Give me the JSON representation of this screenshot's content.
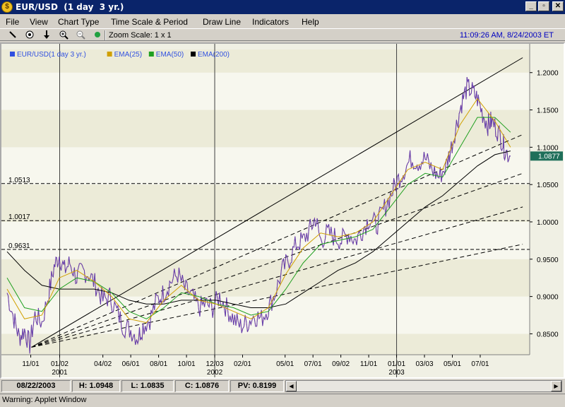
{
  "window": {
    "title": "EUR/USD  (1 day  3 yr.)",
    "icon_letter": "$",
    "controls": {
      "minimize": "_",
      "restore": "▫",
      "close": "✕"
    }
  },
  "menu": {
    "items": [
      "File",
      "View",
      "Chart Type",
      "Time Scale & Period",
      "Draw Line",
      "Indicators",
      "Help"
    ]
  },
  "toolbar": {
    "icons": [
      "draw-line-icon",
      "radio-target-icon",
      "down-arrow-icon",
      "zoom-in-icon",
      "zoom-out-icon",
      "green-dot-icon"
    ],
    "zoom_label": "Zoom Scale: 1 x 1",
    "clock": "11:09:26 AM, 8/24/2003 ET"
  },
  "chart_data": {
    "type": "line",
    "legend": [
      {
        "label": "EUR/USD(1 day  3 yr.)",
        "color": "#3050e0"
      },
      {
        "label": "EMA(25)",
        "color": "#d0a000"
      },
      {
        "label": "EMA(50)",
        "color": "#20a020"
      },
      {
        "label": "EMA(200)",
        "color": "#000000"
      }
    ],
    "y_ticks": [
      "1.2000",
      "1.1500",
      "1.1000",
      "1.0500",
      "1.0000",
      "0.9500",
      "0.9000",
      "0.8500"
    ],
    "ylim": [
      0.822,
      1.231
    ],
    "x_ticks": [
      {
        "label": "11/01",
        "t": 0.068
      },
      {
        "label": "01/02",
        "t": 0.151
      },
      {
        "label": "04/02",
        "t": 0.275
      },
      {
        "label": "06/01",
        "t": 0.355
      },
      {
        "label": "08/01",
        "t": 0.435
      },
      {
        "label": "10/01",
        "t": 0.515
      },
      {
        "label": "12/03",
        "t": 0.596
      },
      {
        "label": "02/01",
        "t": 0.676
      },
      {
        "label": "05/01",
        "t": 0.798
      },
      {
        "label": "07/01",
        "t": 0.878
      },
      {
        "label": "09/02",
        "t": 0.958
      },
      {
        "label": "11/01",
        "t": 1.038
      },
      {
        "label": "01/01",
        "t": 1.118
      },
      {
        "label": "03/03",
        "t": 1.198
      },
      {
        "label": "05/01",
        "t": 1.278
      },
      {
        "label": "07/01",
        "t": 1.358
      }
    ],
    "year_labels": [
      {
        "label": "2001",
        "t": 0.151
      },
      {
        "label": "2002",
        "t": 0.596
      },
      {
        "label": "2003",
        "t": 1.118
      }
    ],
    "year_separators": [
      0.151,
      0.596,
      1.118
    ],
    "last_price_label": "1.0877",
    "last_price": 1.0877,
    "fib_labels": [
      {
        "label": "1.0513",
        "price": 1.0513
      },
      {
        "label": "1.0017",
        "price": 1.0017
      },
      {
        "label": "0.9631",
        "price": 0.9631
      }
    ],
    "price_path": [
      [
        0.0,
        0.905
      ],
      [
        0.02,
        0.87
      ],
      [
        0.035,
        0.845
      ],
      [
        0.05,
        0.855
      ],
      [
        0.065,
        0.835
      ],
      [
        0.08,
        0.875
      ],
      [
        0.1,
        0.865
      ],
      [
        0.12,
        0.905
      ],
      [
        0.135,
        0.94
      ],
      [
        0.15,
        0.955
      ],
      [
        0.165,
        0.935
      ],
      [
        0.18,
        0.945
      ],
      [
        0.2,
        0.925
      ],
      [
        0.215,
        0.935
      ],
      [
        0.235,
        0.93
      ],
      [
        0.255,
        0.915
      ],
      [
        0.275,
        0.895
      ],
      [
        0.295,
        0.9
      ],
      [
        0.315,
        0.88
      ],
      [
        0.335,
        0.86
      ],
      [
        0.355,
        0.855
      ],
      [
        0.375,
        0.845
      ],
      [
        0.39,
        0.86
      ],
      [
        0.41,
        0.87
      ],
      [
        0.43,
        0.895
      ],
      [
        0.45,
        0.905
      ],
      [
        0.47,
        0.92
      ],
      [
        0.49,
        0.93
      ],
      [
        0.51,
        0.91
      ],
      [
        0.53,
        0.9
      ],
      [
        0.55,
        0.885
      ],
      [
        0.57,
        0.89
      ],
      [
        0.59,
        0.885
      ],
      [
        0.61,
        0.9
      ],
      [
        0.63,
        0.885
      ],
      [
        0.65,
        0.87
      ],
      [
        0.67,
        0.86
      ],
      [
        0.69,
        0.865
      ],
      [
        0.71,
        0.875
      ],
      [
        0.73,
        0.87
      ],
      [
        0.75,
        0.885
      ],
      [
        0.77,
        0.905
      ],
      [
        0.79,
        0.935
      ],
      [
        0.81,
        0.95
      ],
      [
        0.83,
        0.97
      ],
      [
        0.85,
        0.975
      ],
      [
        0.87,
        0.99
      ],
      [
        0.885,
        1.005
      ],
      [
        0.9,
        0.975
      ],
      [
        0.92,
        0.985
      ],
      [
        0.94,
        0.98
      ],
      [
        0.96,
        0.975
      ],
      [
        0.98,
        0.985
      ],
      [
        1.0,
        0.975
      ],
      [
        1.02,
        0.99
      ],
      [
        1.04,
        1.005
      ],
      [
        1.06,
        0.995
      ],
      [
        1.08,
        1.015
      ],
      [
        1.1,
        1.035
      ],
      [
        1.12,
        1.055
      ],
      [
        1.14,
        1.07
      ],
      [
        1.16,
        1.085
      ],
      [
        1.18,
        1.08
      ],
      [
        1.2,
        1.085
      ],
      [
        1.22,
        1.07
      ],
      [
        1.24,
        1.06
      ],
      [
        1.26,
        1.075
      ],
      [
        1.275,
        1.1
      ],
      [
        1.29,
        1.13
      ],
      [
        1.305,
        1.16
      ],
      [
        1.32,
        1.18
      ],
      [
        1.335,
        1.175
      ],
      [
        1.35,
        1.165
      ],
      [
        1.365,
        1.145
      ],
      [
        1.38,
        1.13
      ],
      [
        1.39,
        1.135
      ],
      [
        1.405,
        1.125
      ],
      [
        1.42,
        1.11
      ],
      [
        1.43,
        1.095
      ],
      [
        1.445,
        1.088
      ]
    ],
    "ema25_path": [
      [
        0.0,
        0.91
      ],
      [
        0.05,
        0.87
      ],
      [
        0.1,
        0.875
      ],
      [
        0.15,
        0.925
      ],
      [
        0.2,
        0.935
      ],
      [
        0.25,
        0.92
      ],
      [
        0.3,
        0.9
      ],
      [
        0.35,
        0.87
      ],
      [
        0.4,
        0.865
      ],
      [
        0.45,
        0.895
      ],
      [
        0.5,
        0.915
      ],
      [
        0.55,
        0.895
      ],
      [
        0.6,
        0.89
      ],
      [
        0.65,
        0.88
      ],
      [
        0.7,
        0.87
      ],
      [
        0.75,
        0.885
      ],
      [
        0.8,
        0.93
      ],
      [
        0.85,
        0.965
      ],
      [
        0.9,
        0.985
      ],
      [
        0.95,
        0.98
      ],
      [
        1.0,
        0.985
      ],
      [
        1.05,
        1.0
      ],
      [
        1.1,
        1.035
      ],
      [
        1.15,
        1.07
      ],
      [
        1.2,
        1.08
      ],
      [
        1.25,
        1.07
      ],
      [
        1.3,
        1.13
      ],
      [
        1.35,
        1.165
      ],
      [
        1.4,
        1.135
      ],
      [
        1.445,
        1.1
      ]
    ],
    "ema50_path": [
      [
        0.0,
        0.925
      ],
      [
        0.05,
        0.885
      ],
      [
        0.1,
        0.88
      ],
      [
        0.15,
        0.91
      ],
      [
        0.2,
        0.925
      ],
      [
        0.25,
        0.92
      ],
      [
        0.3,
        0.905
      ],
      [
        0.35,
        0.88
      ],
      [
        0.4,
        0.87
      ],
      [
        0.45,
        0.885
      ],
      [
        0.5,
        0.905
      ],
      [
        0.55,
        0.9
      ],
      [
        0.6,
        0.89
      ],
      [
        0.65,
        0.885
      ],
      [
        0.7,
        0.875
      ],
      [
        0.75,
        0.88
      ],
      [
        0.8,
        0.91
      ],
      [
        0.85,
        0.945
      ],
      [
        0.9,
        0.97
      ],
      [
        0.95,
        0.975
      ],
      [
        1.0,
        0.98
      ],
      [
        1.05,
        0.99
      ],
      [
        1.1,
        1.02
      ],
      [
        1.15,
        1.05
      ],
      [
        1.2,
        1.065
      ],
      [
        1.25,
        1.06
      ],
      [
        1.3,
        1.1
      ],
      [
        1.35,
        1.14
      ],
      [
        1.4,
        1.14
      ],
      [
        1.445,
        1.12
      ]
    ],
    "ema200_path": [
      [
        0.0,
        0.96
      ],
      [
        0.05,
        0.935
      ],
      [
        0.1,
        0.915
      ],
      [
        0.15,
        0.91
      ],
      [
        0.2,
        0.91
      ],
      [
        0.25,
        0.91
      ],
      [
        0.3,
        0.905
      ],
      [
        0.35,
        0.895
      ],
      [
        0.4,
        0.89
      ],
      [
        0.45,
        0.89
      ],
      [
        0.5,
        0.895
      ],
      [
        0.55,
        0.895
      ],
      [
        0.6,
        0.895
      ],
      [
        0.65,
        0.89
      ],
      [
        0.7,
        0.885
      ],
      [
        0.75,
        0.885
      ],
      [
        0.8,
        0.89
      ],
      [
        0.85,
        0.905
      ],
      [
        0.9,
        0.92
      ],
      [
        0.95,
        0.935
      ],
      [
        1.0,
        0.945
      ],
      [
        1.05,
        0.96
      ],
      [
        1.1,
        0.98
      ],
      [
        1.15,
        1.0
      ],
      [
        1.2,
        1.02
      ],
      [
        1.25,
        1.035
      ],
      [
        1.3,
        1.055
      ],
      [
        1.35,
        1.075
      ],
      [
        1.4,
        1.09
      ],
      [
        1.445,
        1.095
      ]
    ],
    "trend_lines": [
      {
        "from": [
          0.07,
          0.832
        ],
        "to": [
          1.48,
          1.22
        ],
        "style": "solid"
      },
      {
        "from": [
          0.07,
          0.832
        ],
        "to": [
          1.48,
          1.117
        ],
        "style": "dashed"
      },
      {
        "from": [
          0.07,
          0.832
        ],
        "to": [
          1.48,
          1.065
        ],
        "style": "dashed"
      },
      {
        "from": [
          0.07,
          0.832
        ],
        "to": [
          1.48,
          1.02
        ],
        "style": "dashed"
      },
      {
        "from": [
          0.07,
          0.832
        ],
        "to": [
          1.48,
          0.97
        ],
        "style": "dashed"
      }
    ]
  },
  "status": {
    "date": "08/22/2003",
    "high": "H: 1.0948",
    "low": "L: 1.0835",
    "close": "C: 1.0876",
    "pv": "PV: 0.8199",
    "scroll_left": "◀",
    "scroll_right": "▶"
  },
  "warning": "Warning: Applet Window"
}
